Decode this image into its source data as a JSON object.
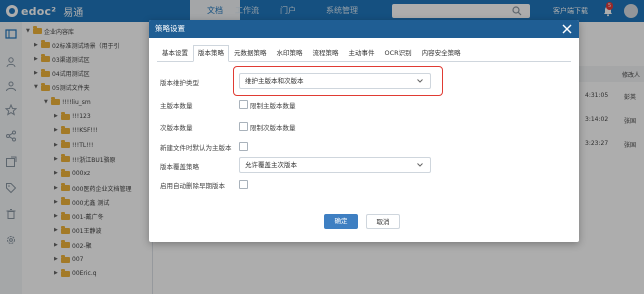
{
  "header": {
    "logo_text": "edoc²",
    "logo_cn": "易通",
    "tabs": [
      "文档",
      "工作流",
      "门户",
      "系统管理"
    ],
    "download_label": "客户端下载",
    "notification_count": "5"
  },
  "tree": {
    "root": "企业内容库",
    "items": [
      {
        "label": "02标准测试场景（用于引",
        "indent": 0,
        "open": false
      },
      {
        "label": "03渠道测试区",
        "indent": 0,
        "open": false
      },
      {
        "label": "04试用测试区",
        "indent": 0,
        "open": false
      },
      {
        "label": "05测试文件夹",
        "indent": 0,
        "open": true
      },
      {
        "label": "!!!!liu_sm",
        "indent": 1,
        "open": true
      },
      {
        "label": "!!!123",
        "indent": 2,
        "open": false
      },
      {
        "label": "!!!KSF!!!",
        "indent": 2,
        "open": false
      },
      {
        "label": "!!!TL!!!",
        "indent": 2,
        "open": false
      },
      {
        "label": "!!!浙江BU1骆原",
        "indent": 2,
        "open": false
      },
      {
        "label": "000xz",
        "indent": 2,
        "open": false
      },
      {
        "label": "000医药企业文档管理",
        "indent": 2,
        "open": false
      },
      {
        "label": "000尤鑫 测试",
        "indent": 2,
        "open": false
      },
      {
        "label": "001-戴广冬",
        "indent": 2,
        "open": false
      },
      {
        "label": "001王静波",
        "indent": 2,
        "open": false
      },
      {
        "label": "002-聚",
        "indent": 2,
        "open": false
      },
      {
        "label": "007",
        "indent": 2,
        "open": false
      },
      {
        "label": "00Eric.q",
        "indent": 2,
        "open": false
      }
    ]
  },
  "list": {
    "column_modifier": "修改人",
    "rows": [
      {
        "time": "4:31:05",
        "user": "彭英"
      },
      {
        "time": "3:14:02",
        "user": "张国"
      },
      {
        "time": "3:23:27",
        "user": "张国"
      }
    ]
  },
  "modal": {
    "title": "策略设置",
    "tabs": [
      "基本设置",
      "版本策略",
      "元数据策略",
      "水印策略",
      "流程策略",
      "主动事件",
      "OCR识别",
      "内容安全策略"
    ],
    "active_tab": 1,
    "fields": {
      "version_type_label": "版本维护类型",
      "version_type_value": "维护主版本和次版本",
      "major_count_label": "主版本数量",
      "major_limit_label": "限制主版本数量",
      "minor_count_label": "次版本数量",
      "minor_limit_label": "限制次版本数量",
      "new_as_major_label": "新建文件时默认为主版本",
      "overwrite_label": "版本覆盖策略",
      "overwrite_value": "允许覆盖主次版本",
      "auto_delete_label": "启用自动删除早期版本"
    },
    "buttons": {
      "ok": "确定",
      "cancel": "取消"
    }
  },
  "colors": {
    "brand": "#1f77bd",
    "dialog_header": "#1f5e94",
    "highlight": "#e03b33",
    "primary_button": "#3e7fc2"
  }
}
